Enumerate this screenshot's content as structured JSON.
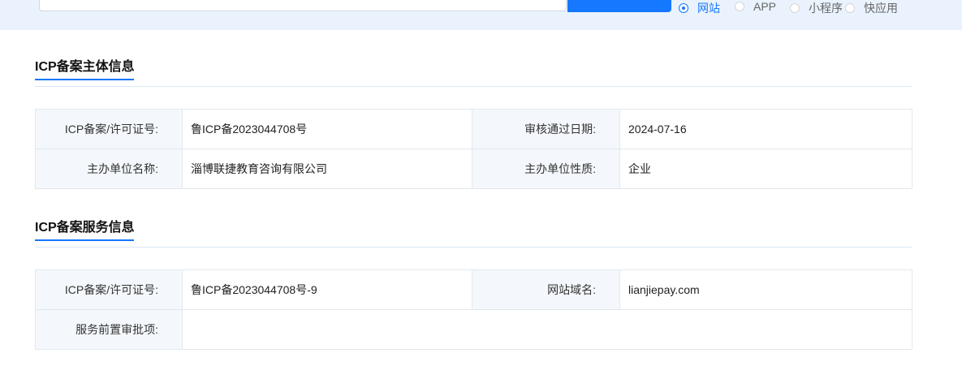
{
  "search": {
    "input_value": "",
    "button_label": ""
  },
  "type_options": [
    {
      "label": "网站",
      "checked": true
    },
    {
      "label": "APP",
      "checked": false
    },
    {
      "label": "小程序",
      "checked": false
    },
    {
      "label": "快应用",
      "checked": false
    }
  ],
  "subject_section": {
    "title": "ICP备案主体信息",
    "rows": [
      {
        "label1": "ICP备案/许可证号:",
        "value1": "鲁ICP备2023044708号",
        "label2": "审核通过日期:",
        "value2": "2024-07-16"
      },
      {
        "label1": "主办单位名称:",
        "value1": "淄博联捷教育咨询有限公司",
        "label2": "主办单位性质:",
        "value2": "企业"
      }
    ]
  },
  "service_section": {
    "title": "ICP备案服务信息",
    "rows": [
      {
        "label1": "ICP备案/许可证号:",
        "value1": "鲁ICP备2023044708号-9",
        "label2": "网站域名:",
        "value2": "lianjiepay.com"
      }
    ],
    "approval": {
      "label": "服务前置审批项:",
      "value": ""
    }
  },
  "colors": {
    "accent": "#1677ff",
    "label_bg": "#f4f8fc",
    "topbar_bg": "#eaf3fd"
  }
}
